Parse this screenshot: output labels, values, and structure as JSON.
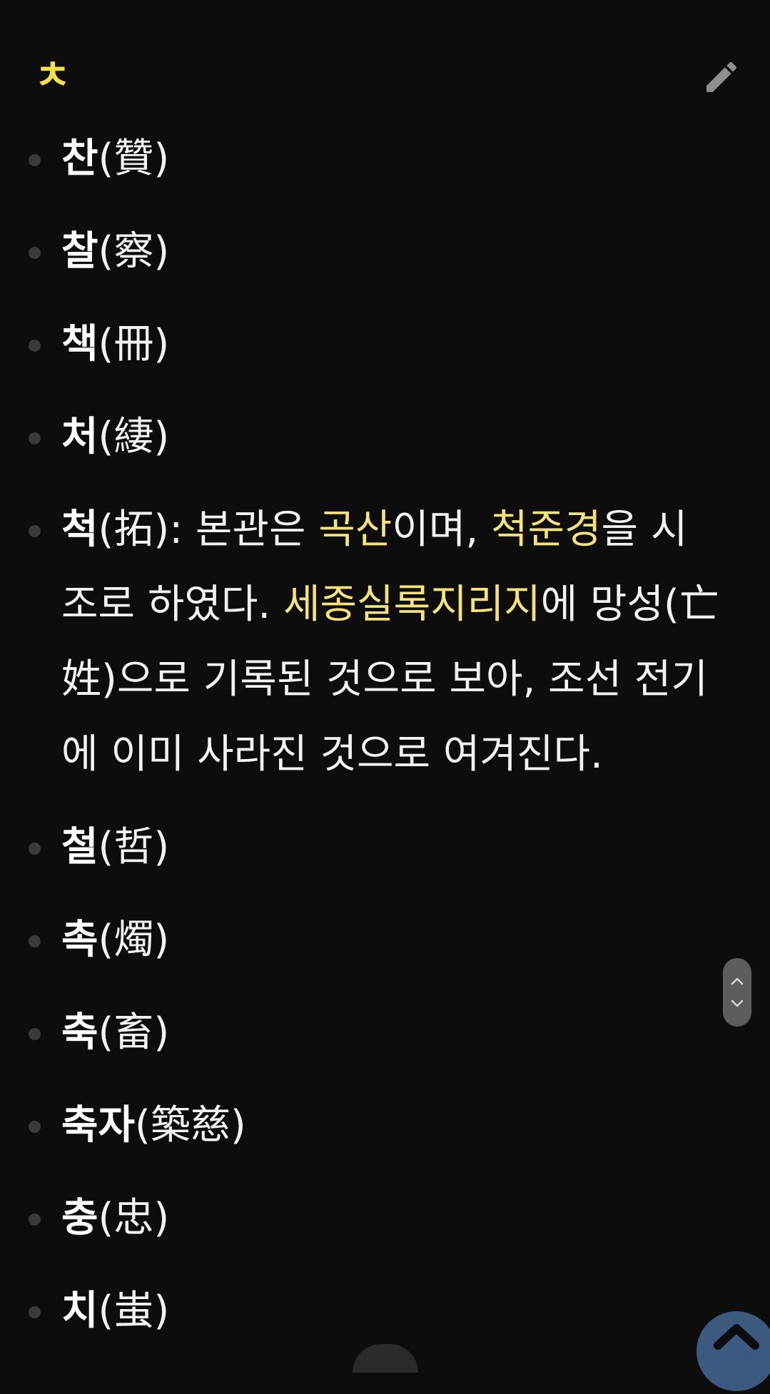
{
  "section": {
    "title": "ㅊ",
    "edit_icon": "pencil-icon"
  },
  "previous_entry_partial": "",
  "surnames": [
    {
      "name": "찬",
      "hanja": "(贊)"
    },
    {
      "name": "찰",
      "hanja": "(察)"
    },
    {
      "name": "책",
      "hanja": "(冊)"
    },
    {
      "name": "처",
      "hanja": "(緀)"
    },
    {
      "name": "척",
      "hanja": "(拓)",
      "desc_1": ": 본관은 ",
      "link_1": "곡산",
      "desc_2": "이며, ",
      "link_2": "척준경",
      "desc_3": "을 시조로 하였다. ",
      "link_3": "세종실록지리지",
      "desc_4": "에 망성(亡姓)으로 기록된 것으로 보아, 조선 전기에 이미 사라진 것으로 여겨진다."
    },
    {
      "name": "철",
      "hanja": "(哲)"
    },
    {
      "name": "촉",
      "hanja": "(燭)"
    },
    {
      "name": "축",
      "hanja": "(畜)"
    },
    {
      "name": "축자",
      "hanja": "(築慈)"
    },
    {
      "name": "충",
      "hanja": "(忠)"
    },
    {
      "name": "치",
      "hanja": "(蚩)"
    }
  ],
  "colors": {
    "background": "#0d0d0d",
    "header_accent": "#f2e04a",
    "link": "#f3e37a",
    "bullet": "#3a3a3a"
  },
  "controls": {
    "scroll_handle_icon": "scroll-up-down-icon",
    "back_to_top_icon": "chevron-up-icon"
  }
}
